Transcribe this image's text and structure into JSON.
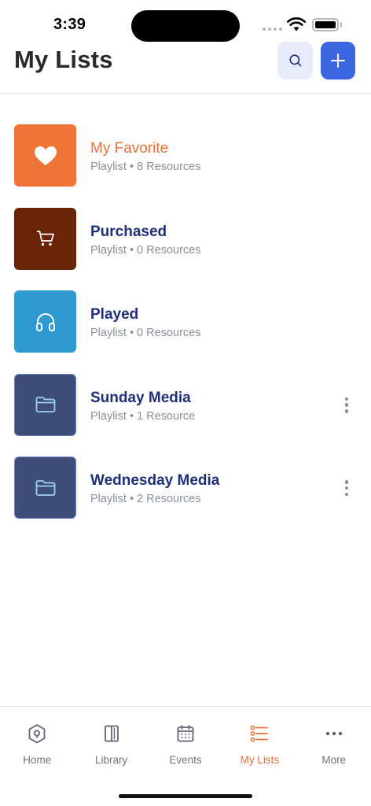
{
  "status_bar": {
    "time": "3:39"
  },
  "header": {
    "title": "My Lists",
    "search_icon": "search-icon",
    "add_icon": "plus-icon"
  },
  "colors": {
    "accent_orange": "#E8733A",
    "primary_blue": "#3B66E0",
    "title_navy": "#1F2F78"
  },
  "lists": [
    {
      "title": "My Favorite",
      "subtitle": "Playlist • 8 Resources",
      "icon": "heart-icon",
      "color": "#EE7537",
      "has_menu": false,
      "highlight": true
    },
    {
      "title": "Purchased",
      "subtitle": "Playlist • 0 Resources",
      "icon": "cart-icon",
      "color": "#6A2406",
      "has_menu": false,
      "highlight": false
    },
    {
      "title": "Played",
      "subtitle": "Playlist • 0 Resources",
      "icon": "headphones-icon",
      "color": "#2F9ACF",
      "has_menu": false,
      "highlight": false
    },
    {
      "title": "Sunday Media",
      "subtitle": "Playlist • 1 Resource",
      "icon": "folder-icon",
      "color": "#3F4E78",
      "has_menu": true,
      "highlight": false
    },
    {
      "title": "Wednesday Media",
      "subtitle": "Playlist • 2 Resources",
      "icon": "folder-icon",
      "color": "#3F4E78",
      "has_menu": true,
      "highlight": false
    }
  ],
  "tabs": [
    {
      "label": "Home",
      "icon": "home-icon",
      "active": false
    },
    {
      "label": "Library",
      "icon": "library-icon",
      "active": false
    },
    {
      "label": "Events",
      "icon": "calendar-icon",
      "active": false
    },
    {
      "label": "My Lists",
      "icon": "list-icon",
      "active": true
    },
    {
      "label": "More",
      "icon": "more-horizontal-icon",
      "active": false
    }
  ]
}
